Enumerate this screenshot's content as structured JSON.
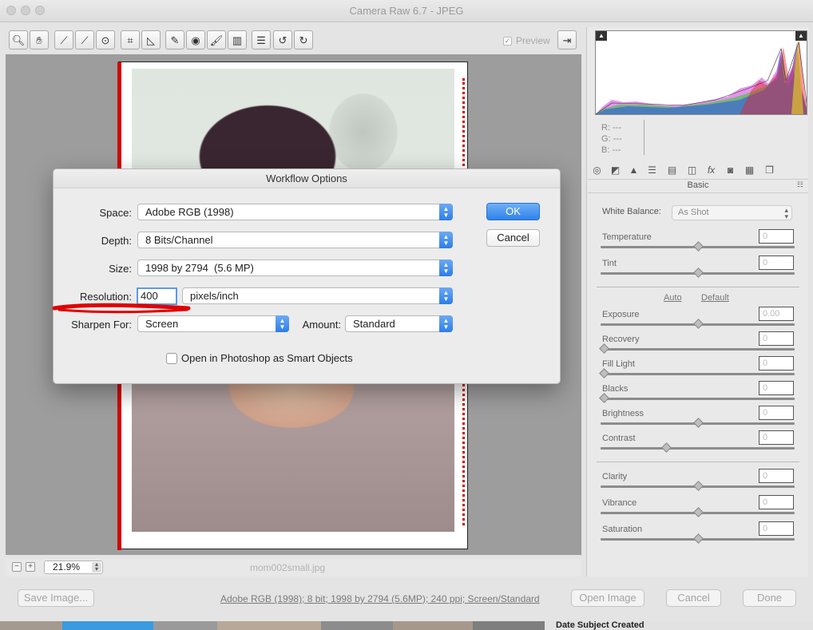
{
  "window": {
    "title": "Camera Raw 6.7  -  JPEG"
  },
  "toolbar": {
    "preview_label": "Preview",
    "preview_checked": "✓",
    "tools": [
      "zoom-icon",
      "hand-icon",
      "white-balance-icon",
      "color-sampler-icon",
      "target-adjustment-icon",
      "crop-icon",
      "straighten-icon",
      "spot-removal-icon",
      "red-eye-icon",
      "adjustment-brush-icon",
      "graduated-filter-icon",
      "preferences-icon",
      "rotate-left-icon",
      "rotate-right-icon"
    ]
  },
  "zoom": {
    "minus": "−",
    "plus": "+",
    "value": "21.9%",
    "filename": "mom002small.jpg"
  },
  "histogram": {
    "r_label": "R:",
    "g_label": "G:",
    "b_label": "B:",
    "r": "---",
    "g": "---",
    "b": "---"
  },
  "panel": {
    "title": "Basic",
    "white_balance_label": "White Balance:",
    "white_balance_value": "As Shot",
    "auto": "Auto",
    "default": "Default",
    "sliders": [
      {
        "label": "Temperature",
        "value": "0",
        "pos": 0.5
      },
      {
        "label": "Tint",
        "value": "0",
        "pos": 0.5
      },
      {
        "label": "Exposure",
        "value": "0.00",
        "pos": 0.5
      },
      {
        "label": "Recovery",
        "value": "0",
        "pos": 0.0
      },
      {
        "label": "Fill Light",
        "value": "0",
        "pos": 0.0
      },
      {
        "label": "Blacks",
        "value": "0",
        "pos": 0.0
      },
      {
        "label": "Brightness",
        "value": "0",
        "pos": 0.5
      },
      {
        "label": "Contrast",
        "value": "0",
        "pos": 0.33
      },
      {
        "label": "Clarity",
        "value": "0",
        "pos": 0.5
      },
      {
        "label": "Vibrance",
        "value": "0",
        "pos": 0.5
      },
      {
        "label": "Saturation",
        "value": "0",
        "pos": 0.5
      }
    ]
  },
  "dialog": {
    "title": "Workflow Options",
    "space_label": "Space:",
    "space_value": "Adobe RGB (1998)",
    "depth_label": "Depth:",
    "depth_value": "8 Bits/Channel",
    "size_label": "Size:",
    "size_value": "1998 by 2794  (5.6 MP)",
    "resolution_label": "Resolution:",
    "resolution_value": "400",
    "resolution_unit": "pixels/inch",
    "sharpen_label": "Sharpen For:",
    "sharpen_value": "Screen",
    "amount_label": "Amount:",
    "amount_value": "Standard",
    "smart_objects_label": "Open in Photoshop as Smart Objects",
    "ok_label": "OK",
    "cancel_label": "Cancel"
  },
  "footer": {
    "save_image": "Save Image...",
    "workflow_link": "Adobe RGB (1998); 8 bit; 1998 by 2794 (5.6MP); 240 ppi; Screen/Standard",
    "open_image": "Open Image",
    "cancel": "Cancel",
    "done": "Done"
  },
  "background_app": {
    "column_header": "Date Subject Created"
  },
  "colors": {
    "accent": "#2f82ea",
    "clip_warning": "#d30000",
    "annotation": "#e00000"
  }
}
